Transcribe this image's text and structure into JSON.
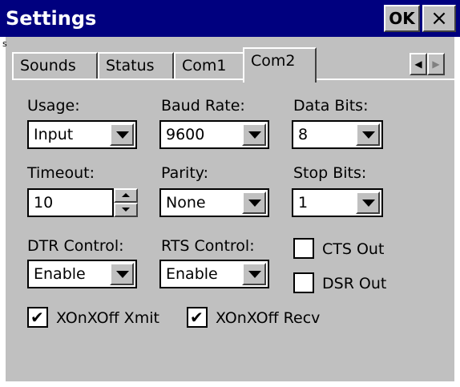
{
  "window": {
    "title": "Settings",
    "ok_label": "OK",
    "close_label": "×"
  },
  "tabs": [
    "Sounds",
    "Status",
    "Com1",
    "Com2"
  ],
  "active_tab": "Com2",
  "scroll": {
    "left": "◀",
    "right": "▶"
  },
  "fields": {
    "usage": {
      "label": "Usage:",
      "value": "Input"
    },
    "baud_rate": {
      "label": "Baud Rate:",
      "value": "9600"
    },
    "data_bits": {
      "label": "Data Bits:",
      "value": "8"
    },
    "timeout": {
      "label": "Timeout:",
      "value": "10"
    },
    "parity": {
      "label": "Parity:",
      "value": "None"
    },
    "stop_bits": {
      "label": "Stop Bits:",
      "value": "1"
    },
    "dtr_control": {
      "label": "DTR Control:",
      "value": "Enable"
    },
    "rts_control": {
      "label": "RTS Control:",
      "value": "Enable"
    }
  },
  "checkboxes": {
    "cts_out": {
      "label": "CTS Out",
      "checked": false
    },
    "dsr_out": {
      "label": "DSR Out",
      "checked": false
    },
    "xonxoff_xmit": {
      "label": "XOnXOff Xmit",
      "checked": true
    },
    "xonxoff_recv": {
      "label": "XOnXOff Recv",
      "checked": true
    }
  },
  "check_glyph": "✔"
}
